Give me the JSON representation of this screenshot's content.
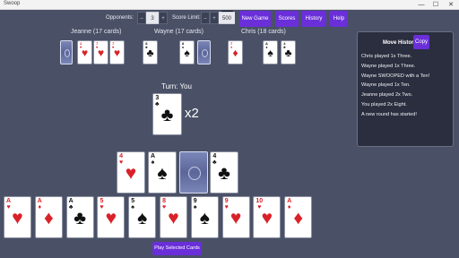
{
  "window": {
    "title": "Swoop",
    "min": "—",
    "max": "☐",
    "close": "✕"
  },
  "toolbar": {
    "opponents_label": "Opponents:",
    "opponents_value": "3",
    "score_limit_label": "Score Limit:",
    "score_limit_value": "500",
    "score_limit_hint": "500",
    "minus": "–",
    "plus": "+",
    "new_game": "New Game",
    "scores": "Scores",
    "history": "History",
    "help": "Help"
  },
  "opponents": [
    {
      "name": "Jeanne",
      "cards": "(17 cards)",
      "face_up": [
        {
          "rank": "2",
          "suit": "♥",
          "color": "red"
        },
        {
          "rank": "7",
          "suit": "♥",
          "color": "red"
        },
        {
          "rank": "7",
          "suit": "♥",
          "color": "red"
        }
      ]
    },
    {
      "name": "Wayne",
      "cards": "(17 cards)",
      "face_up": [
        {
          "rank": "8",
          "suit": "♣",
          "color": "blk"
        },
        {
          "rank": "8",
          "suit": "♠",
          "color": "blk"
        }
      ]
    },
    {
      "name": "Chris",
      "cards": "(18 cards)",
      "face_up": [
        {
          "rank": "7",
          "suit": "♦",
          "color": "red"
        },
        {
          "rank": "A",
          "suit": "♠",
          "color": "blk"
        },
        {
          "rank": "4",
          "suit": "♣",
          "color": "blk"
        }
      ]
    }
  ],
  "turn": {
    "label": "Turn: You",
    "card": {
      "rank": "3",
      "suit": "♣",
      "color": "blk"
    },
    "multiplier": "x2"
  },
  "pile": [
    {
      "rank": "4",
      "suit": "♥",
      "color": "red"
    },
    {
      "rank": "A",
      "suit": "♠",
      "color": "blk"
    },
    {
      "rank": "4",
      "suit": "♣",
      "color": "blk"
    }
  ],
  "hand": [
    {
      "rank": "A",
      "suit": "♥",
      "color": "red"
    },
    {
      "rank": "A",
      "suit": "♦",
      "color": "red"
    },
    {
      "rank": "A",
      "suit": "♣",
      "color": "blk"
    },
    {
      "rank": "5",
      "suit": "♥",
      "color": "red"
    },
    {
      "rank": "5",
      "suit": "♠",
      "color": "blk"
    },
    {
      "rank": "8",
      "suit": "♥",
      "color": "red"
    },
    {
      "rank": "9",
      "suit": "♠",
      "color": "blk"
    },
    {
      "rank": "9",
      "suit": "♥",
      "color": "red"
    },
    {
      "rank": "10",
      "suit": "♥",
      "color": "red"
    },
    {
      "rank": "A",
      "suit": "♦",
      "color": "red"
    }
  ],
  "play_button": "Play Selected Cards",
  "move_history": {
    "title": "Move History",
    "copy": "Copy",
    "entries": [
      "Chris played 1x Three.",
      "Wayne played 1x Three.",
      "Wayne SWOOPED with a Ten!",
      "Wayne played 1x Ten.",
      "Jeanne played 2x Two.",
      "You played 2x Eight.",
      "A new round has started!"
    ]
  }
}
